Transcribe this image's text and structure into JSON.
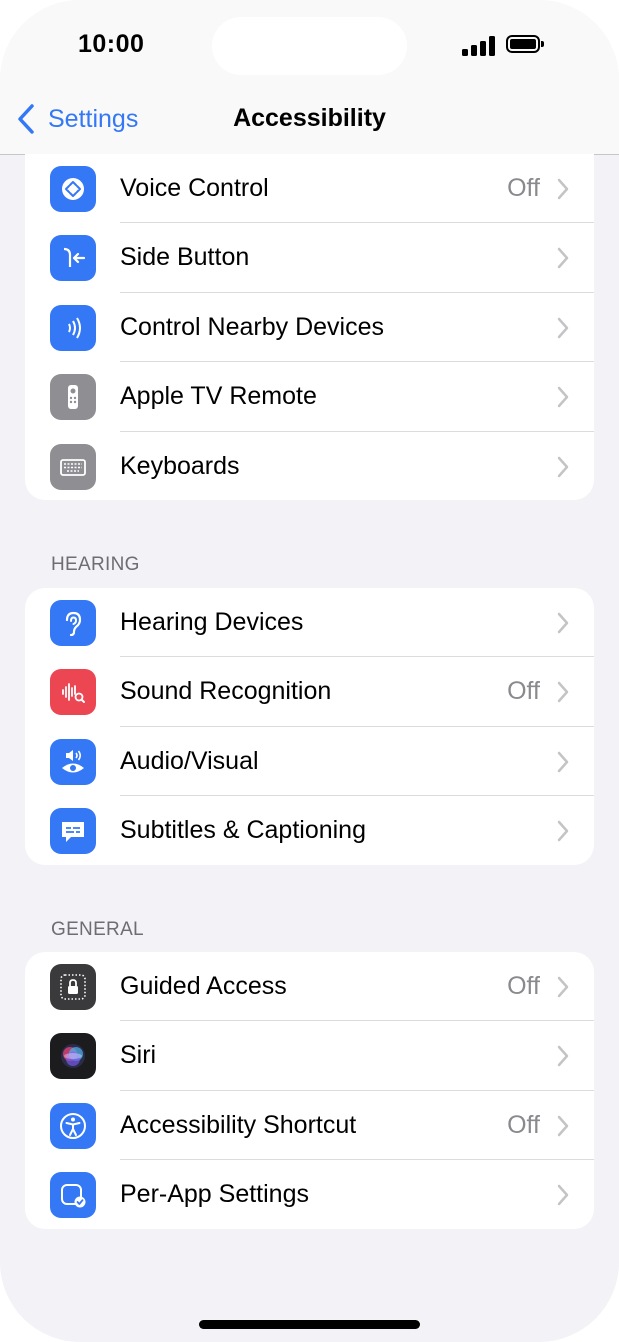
{
  "status_bar": {
    "time": "10:00"
  },
  "nav": {
    "back_label": "Settings",
    "title": "Accessibility"
  },
  "colors": {
    "accent": "#3478f6",
    "blue_icon": "#3478f6",
    "gray_icon": "#8e8e93",
    "red_icon": "#ec4653",
    "dark_icon": "#3a3a3c"
  },
  "groups": {
    "top": {
      "rows": [
        {
          "label": "Voice Control",
          "value": "Off",
          "icon": "voice-control-icon"
        },
        {
          "label": "Side Button",
          "value": "",
          "icon": "side-button-icon"
        },
        {
          "label": "Control Nearby Devices",
          "value": "",
          "icon": "nearby-devices-icon"
        },
        {
          "label": "Apple TV Remote",
          "value": "",
          "icon": "tv-remote-icon"
        },
        {
          "label": "Keyboards",
          "value": "",
          "icon": "keyboard-icon"
        }
      ]
    },
    "hearing": {
      "header": "HEARING",
      "rows": [
        {
          "label": "Hearing Devices",
          "value": "",
          "icon": "ear-icon"
        },
        {
          "label": "Sound Recognition",
          "value": "Off",
          "icon": "sound-recognition-icon"
        },
        {
          "label": "Audio/Visual",
          "value": "",
          "icon": "audio-visual-icon"
        },
        {
          "label": "Subtitles & Captioning",
          "value": "",
          "icon": "captions-icon"
        }
      ]
    },
    "general": {
      "header": "GENERAL",
      "rows": [
        {
          "label": "Guided Access",
          "value": "Off",
          "icon": "lock-icon"
        },
        {
          "label": "Siri",
          "value": "",
          "icon": "siri-icon"
        },
        {
          "label": "Accessibility Shortcut",
          "value": "Off",
          "icon": "accessibility-icon"
        },
        {
          "label": "Per-App Settings",
          "value": "",
          "icon": "per-app-icon"
        }
      ]
    }
  }
}
